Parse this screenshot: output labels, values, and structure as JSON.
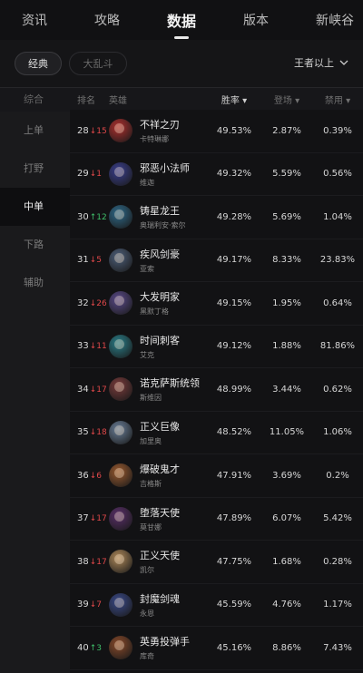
{
  "nav": {
    "tabs": [
      {
        "label": "资讯"
      },
      {
        "label": "攻略"
      },
      {
        "label": "数据"
      },
      {
        "label": "版本"
      },
      {
        "label": "新峡谷"
      }
    ]
  },
  "filters": {
    "mode_selected": "经典",
    "mode_other": "大乱斗",
    "rank": "王者以上"
  },
  "sidebar": {
    "items": [
      "综合",
      "上单",
      "打野",
      "中单",
      "下路",
      "辅助"
    ],
    "active": "中单"
  },
  "table": {
    "headers": {
      "rank": "排名",
      "hero": "英雄",
      "win": "胜率",
      "pick": "登场",
      "ban": "禁用"
    },
    "rows": [
      {
        "rank": "28",
        "trend": "↓15",
        "dir": "down",
        "name": "不祥之刃",
        "sub": "卡特琳娜",
        "win": "49.53%",
        "pick": "2.87%",
        "ban": "0.39%",
        "color": "#b0302e"
      },
      {
        "rank": "29",
        "trend": "↓1",
        "dir": "down",
        "name": "邪恶小法师",
        "sub": "维迦",
        "win": "49.32%",
        "pick": "5.59%",
        "ban": "0.56%",
        "color": "#3a3f8f"
      },
      {
        "rank": "30",
        "trend": "↑12",
        "dir": "up",
        "name": "铸星龙王",
        "sub": "奥瑞利安·索尔",
        "win": "49.28%",
        "pick": "5.69%",
        "ban": "1.04%",
        "color": "#2f6a8a"
      },
      {
        "rank": "31",
        "trend": "↓5",
        "dir": "down",
        "name": "疾风剑豪",
        "sub": "亚索",
        "win": "49.17%",
        "pick": "8.33%",
        "ban": "23.83%",
        "color": "#4d5f7a"
      },
      {
        "rank": "32",
        "trend": "↓26",
        "dir": "down",
        "name": "大发明家",
        "sub": "黑默丁格",
        "win": "49.15%",
        "pick": "1.95%",
        "ban": "0.64%",
        "color": "#5a4a8a"
      },
      {
        "rank": "33",
        "trend": "↓11",
        "dir": "down",
        "name": "时间刺客",
        "sub": "艾克",
        "win": "49.12%",
        "pick": "1.88%",
        "ban": "81.86%",
        "color": "#2a7f8a"
      },
      {
        "rank": "34",
        "trend": "↓17",
        "dir": "down",
        "name": "诺克萨斯统领",
        "sub": "斯维因",
        "win": "48.99%",
        "pick": "3.44%",
        "ban": "0.62%",
        "color": "#7a3b3b"
      },
      {
        "rank": "35",
        "trend": "↓18",
        "dir": "down",
        "name": "正义巨像",
        "sub": "加里奥",
        "win": "48.52%",
        "pick": "11.05%",
        "ban": "1.06%",
        "color": "#6a7f99"
      },
      {
        "rank": "36",
        "trend": "↓6",
        "dir": "down",
        "name": "爆破鬼才",
        "sub": "吉格斯",
        "win": "47.91%",
        "pick": "3.69%",
        "ban": "0.2%",
        "color": "#9a5a2f"
      },
      {
        "rank": "37",
        "trend": "↓17",
        "dir": "down",
        "name": "堕落天使",
        "sub": "莫甘娜",
        "win": "47.89%",
        "pick": "6.07%",
        "ban": "5.42%",
        "color": "#5a2f6a"
      },
      {
        "rank": "38",
        "trend": "↓17",
        "dir": "down",
        "name": "正义天使",
        "sub": "凯尔",
        "win": "47.75%",
        "pick": "1.68%",
        "ban": "0.28%",
        "color": "#b08a5a"
      },
      {
        "rank": "39",
        "trend": "↓7",
        "dir": "down",
        "name": "封魔剑魂",
        "sub": "永恩",
        "win": "45.59%",
        "pick": "4.76%",
        "ban": "1.17%",
        "color": "#3a4a8a"
      },
      {
        "rank": "40",
        "trend": "↑3",
        "dir": "up",
        "name": "英勇投弹手",
        "sub": "库奇",
        "win": "45.16%",
        "pick": "8.86%",
        "ban": "7.43%",
        "color": "#8a4a2a"
      }
    ]
  }
}
